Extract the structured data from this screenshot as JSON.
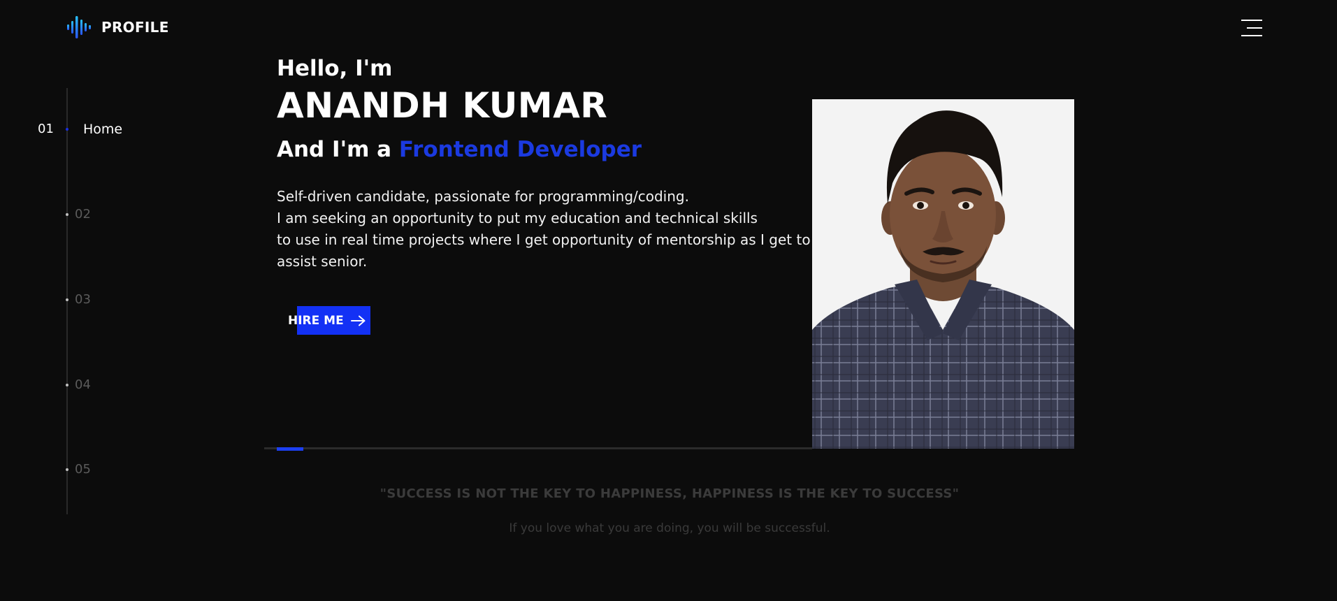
{
  "header": {
    "brand": "PROFILE",
    "logo_icon": "audio-wave-icon",
    "menu_icon": "hamburger-menu-icon"
  },
  "side_nav": {
    "items": [
      {
        "number": "01",
        "label": "Home",
        "active": true
      },
      {
        "number": "02",
        "active": false
      },
      {
        "number": "03",
        "active": false
      },
      {
        "number": "04",
        "active": false
      },
      {
        "number": "05",
        "active": false
      }
    ]
  },
  "hero": {
    "greeting": "Hello, I'm",
    "name": "ANANDH KUMAR",
    "role_prefix": "And I'm a ",
    "role_highlight": "Frontend Developer",
    "bio_lines": [
      "Self-driven candidate, passionate for programming/coding.",
      "I am seeking an opportunity to put my education and technical skills",
      "to use in real time projects where I get opportunity of mentorship as I get to",
      "assist senior."
    ],
    "cta_label": "HIRE ME",
    "cta_icon": "arrow-right-icon"
  },
  "slider": {
    "active_slide": 1,
    "total_slides": 5
  },
  "quote": {
    "text": "\"SUCCESS IS NOT THE KEY TO HAPPINESS, HAPPINESS IS THE KEY TO SUCCESS\"",
    "subtext": "If you love what you are doing, you will be successful."
  },
  "colors": {
    "background": "#0c0c0c",
    "accent": "#1331f5",
    "highlight_text": "#1b3ae0"
  }
}
